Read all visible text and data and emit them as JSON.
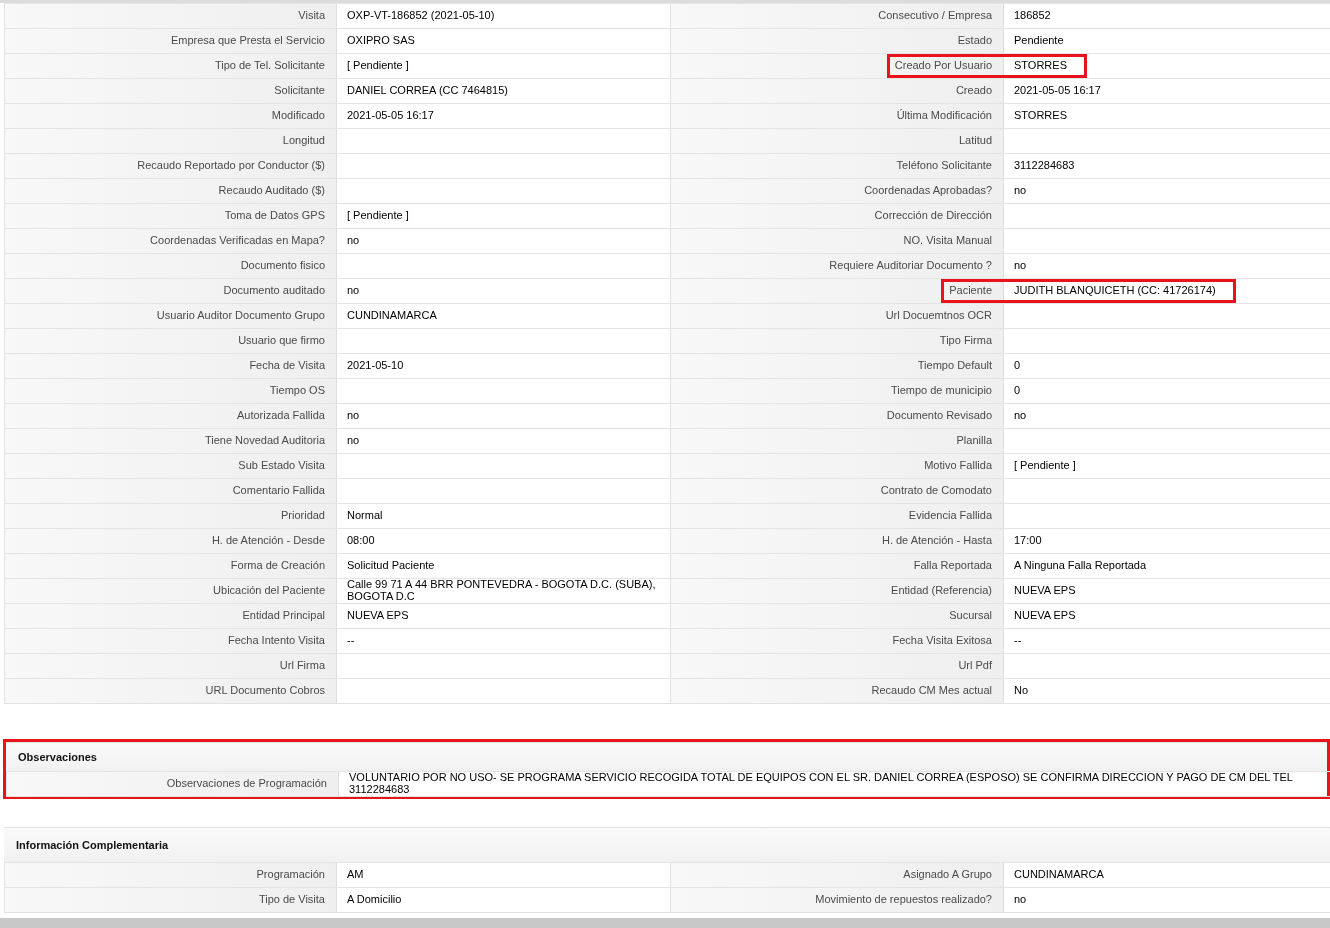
{
  "sections": [
    {
      "rows": [
        {
          "kind": "pair",
          "left": {
            "label": "Visita",
            "value": "OXP-VT-186852 (2021-05-10)",
            "highlighted": false
          },
          "right": {
            "label": "Consecutivo / Empresa",
            "value": "186852",
            "highlighted": false
          }
        },
        {
          "kind": "pair",
          "left": {
            "label": "Empresa que Presta el Servicio",
            "value": "OXIPRO SAS",
            "highlighted": false
          },
          "right": {
            "label": "Estado",
            "value": "Pendiente",
            "highlighted": false
          }
        },
        {
          "kind": "pair",
          "left": {
            "label": "Tipo de Tel. Solicitante",
            "value": "[ Pendiente ]",
            "highlighted": false
          },
          "right": {
            "label": "Creado Por Usuario",
            "value": "STORRES",
            "highlighted": true
          }
        },
        {
          "kind": "pair",
          "left": {
            "label": "Solicitante",
            "value": "DANIEL CORREA (CC 7464815)",
            "highlighted": false
          },
          "right": {
            "label": "Creado",
            "value": "2021-05-05 16:17",
            "highlighted": false
          }
        },
        {
          "kind": "pair",
          "left": {
            "label": "Modificado",
            "value": "2021-05-05 16:17",
            "highlighted": false
          },
          "right": {
            "label": "Última Modificación",
            "value": "STORRES",
            "highlighted": false
          }
        },
        {
          "kind": "pair",
          "left": {
            "label": "Longitud",
            "highlighted": false
          },
          "right": {
            "label": "Latitud",
            "highlighted": false
          }
        },
        {
          "kind": "pair",
          "left": {
            "label": "Recaudo Reportado por Conductor ($)",
            "highlighted": false
          },
          "right": {
            "label": "Teléfono Solicitante",
            "value": "3112284683",
            "highlighted": false
          }
        },
        {
          "kind": "pair",
          "left": {
            "label": "Recaudo Auditado ($)",
            "highlighted": false
          },
          "right": {
            "label": "Coordenadas Aprobadas?",
            "value": "no",
            "highlighted": false
          }
        },
        {
          "kind": "pair",
          "left": {
            "label": "Toma de Datos GPS",
            "value": "[ Pendiente ]",
            "highlighted": false
          },
          "right": {
            "label": "Corrección de Dirección",
            "highlighted": false
          }
        },
        {
          "kind": "pair",
          "left": {
            "label": "Coordenadas Verificadas en Mapa?",
            "value": "no",
            "highlighted": false
          },
          "right": {
            "label": "NO. Visita Manual",
            "highlighted": false
          }
        },
        {
          "kind": "pair",
          "left": {
            "label": "Documento fisico",
            "highlighted": false
          },
          "right": {
            "label": "Requiere Auditoriar Documento ?",
            "value": "no",
            "highlighted": false
          }
        },
        {
          "kind": "pair",
          "left": {
            "label": "Documento auditado",
            "value": "no",
            "highlighted": false
          },
          "right": {
            "label": "Paciente",
            "value": "JUDITH BLANQUICETH (CC: 41726174)",
            "highlighted": true
          }
        },
        {
          "kind": "pair",
          "left": {
            "label": "Usuario Auditor Documento Grupo",
            "value": "CUNDINAMARCA",
            "highlighted": false
          },
          "right": {
            "label": "Url Docuemtnos OCR",
            "highlighted": false
          }
        },
        {
          "kind": "pair",
          "left": {
            "label": "Usuario que firmo",
            "highlighted": false
          },
          "right": {
            "label": "Tipo Firma",
            "highlighted": false
          }
        },
        {
          "kind": "pair",
          "left": {
            "label": "Fecha de Visita",
            "value": "2021-05-10",
            "highlighted": false
          },
          "right": {
            "label": "Tiempo Default",
            "value": "0",
            "highlighted": false
          }
        },
        {
          "kind": "pair",
          "left": {
            "label": "Tiempo OS",
            "highlighted": false
          },
          "right": {
            "label": "Tiempo de municipio",
            "value": "0",
            "highlighted": false
          }
        },
        {
          "kind": "pair",
          "left": {
            "label": "Autorizada Fallida",
            "value": "no",
            "highlighted": false
          },
          "right": {
            "label": "Documento Revisado",
            "value": "no",
            "highlighted": false
          }
        },
        {
          "kind": "pair",
          "left": {
            "label": "Tiene Novedad Auditoria",
            "value": "no",
            "highlighted": false
          },
          "right": {
            "label": "Planilla",
            "highlighted": false
          }
        },
        {
          "kind": "pair",
          "left": {
            "label": "Sub Estado Visita",
            "highlighted": false
          },
          "right": {
            "label": "Motivo Fallida",
            "value": "[ Pendiente ]",
            "highlighted": false
          }
        },
        {
          "kind": "pair",
          "left": {
            "label": "Comentario Fallida",
            "highlighted": false
          },
          "right": {
            "label": "Contrato de Comodato",
            "highlighted": false
          }
        },
        {
          "kind": "pair",
          "left": {
            "label": "Prioridad",
            "value": "Normal",
            "highlighted": false
          },
          "right": {
            "label": "Evidencia Fallida",
            "highlighted": false
          }
        },
        {
          "kind": "pair",
          "left": {
            "label": "H. de Atención - Desde",
            "value": "08:00",
            "highlighted": false
          },
          "right": {
            "label": "H. de Atención - Hasta",
            "value": "17:00",
            "highlighted": false
          }
        },
        {
          "kind": "pair",
          "left": {
            "label": "Forma de Creación",
            "value": "Solicitud Paciente",
            "highlighted": false
          },
          "right": {
            "label": "Falla Reportada",
            "value": "A Ninguna Falla Reportada",
            "highlighted": false
          }
        },
        {
          "kind": "pair",
          "left": {
            "label": "Ubicación del Paciente",
            "value": "Calle 99 71 A 44 BRR PONTEVEDRA - BOGOTA D.C. (SUBA), BOGOTA D.C",
            "highlighted": false
          },
          "right": {
            "label": "Entidad (Referencia)",
            "value": "NUEVA EPS",
            "highlighted": false
          }
        },
        {
          "kind": "pair",
          "left": {
            "label": "Entidad Principal",
            "value": "NUEVA EPS",
            "highlighted": false
          },
          "right": {
            "label": "Sucursal",
            "value": "NUEVA EPS",
            "highlighted": false
          }
        },
        {
          "kind": "pair",
          "left": {
            "label": "Fecha Intento Visita",
            "value": "--",
            "highlighted": false
          },
          "right": {
            "label": "Fecha Visita Exitosa",
            "value": "--",
            "highlighted": false
          }
        },
        {
          "kind": "pair",
          "left": {
            "label": "Url Firma",
            "highlighted": false
          },
          "right": {
            "label": "Url Pdf",
            "highlighted": false
          }
        },
        {
          "kind": "pair",
          "left": {
            "label": "URL Documento Cobros",
            "highlighted": false
          },
          "right": {
            "label": "Recaudo CM Mes actual",
            "value": "No",
            "highlighted": false
          }
        }
      ]
    },
    {
      "title": "Observaciones",
      "highlighted": true,
      "rows": [
        {
          "kind": "wide",
          "field": {
            "label": "Observaciones de Programación",
            "value": "VOLUNTARIO POR NO USO- SE PROGRAMA SERVICIO RECOGIDA TOTAL DE EQUIPOS CON EL SR. DANIEL CORREA (ESPOSO) SE CONFIRMA DIRECCION Y PAGO DE CM DEL TEL 3112284683",
            "highlighted": false
          }
        }
      ]
    },
    {
      "title": "Información Complementaria",
      "rows": [
        {
          "kind": "pair",
          "left": {
            "label": "Programación",
            "value": "AM",
            "highlighted": false
          },
          "right": {
            "label": "Asignado A Grupo",
            "value": "CUNDINAMARCA",
            "highlighted": false
          }
        },
        {
          "kind": "pair",
          "left": {
            "label": "Tipo de Visita",
            "value": "A Domicilio",
            "highlighted": false
          },
          "right": {
            "label": "Movimiento de repuestos realizado?",
            "value": "no",
            "highlighted": false
          }
        }
      ]
    }
  ]
}
